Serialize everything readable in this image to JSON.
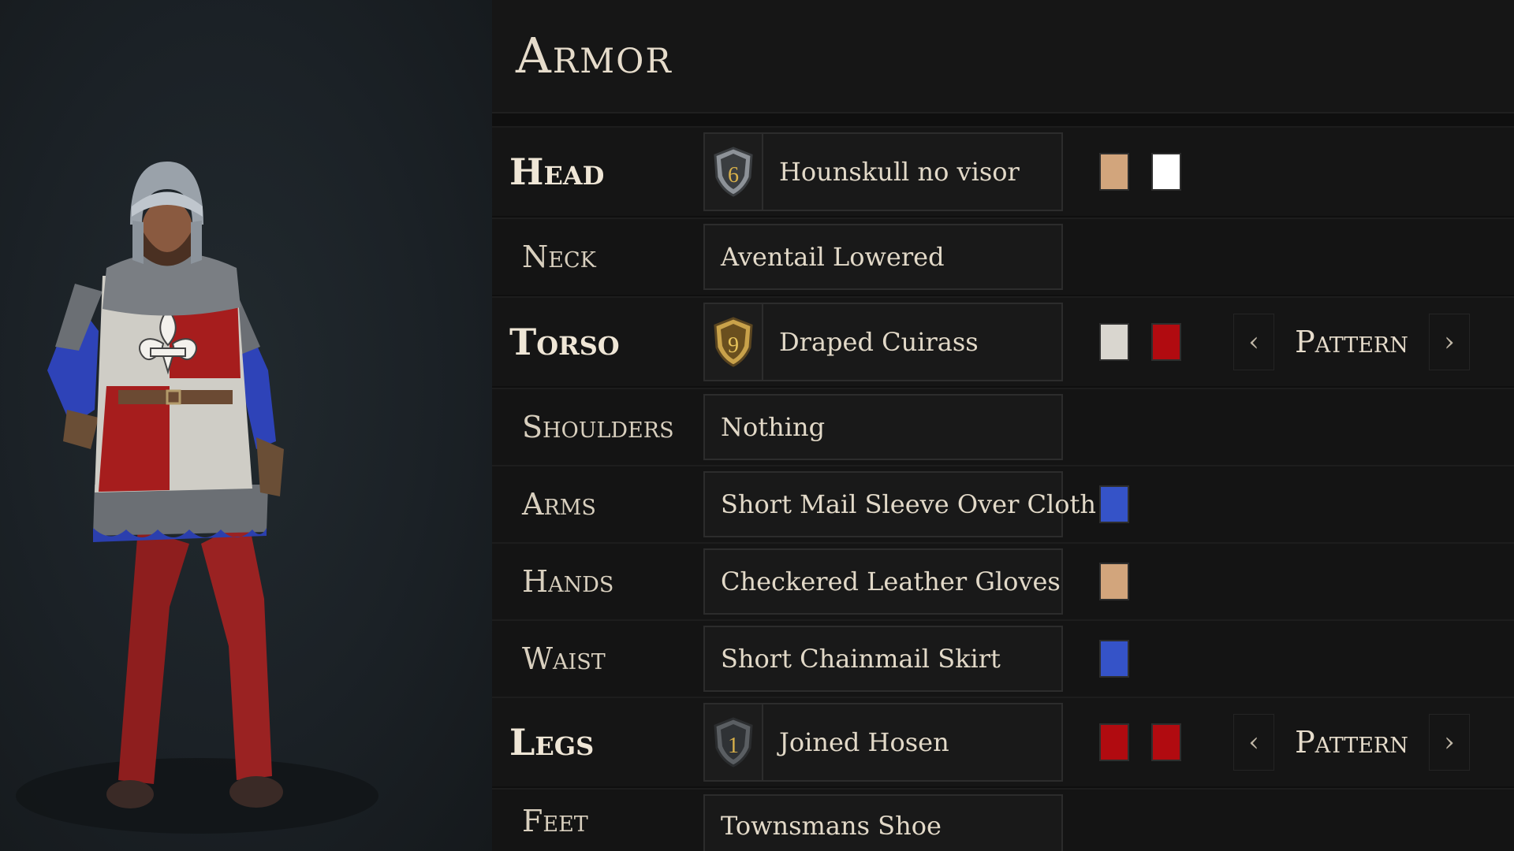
{
  "title": "Armor",
  "rows": [
    {
      "slot": "Head",
      "item": "Hounskull no visor",
      "tier": "6",
      "tier_style": "silver",
      "colors": [
        "#d2a57c",
        "#ffffff"
      ],
      "pattern": ""
    },
    {
      "slot": "Neck",
      "item": "Aventail Lowered"
    },
    {
      "slot": "Torso",
      "item": "Draped Cuirass",
      "tier": "9",
      "tier_style": "gold",
      "colors": [
        "#d9d6cf",
        "#b10b10"
      ],
      "pattern": "Pattern"
    },
    {
      "slot": "Shoulders",
      "item": "Nothing"
    },
    {
      "slot": "Arms",
      "item": "Short Mail Sleeve Over Cloth",
      "colors": [
        "#3553c8"
      ]
    },
    {
      "slot": "Hands",
      "item": "Checkered Leather Gloves",
      "colors": [
        "#d2a57c"
      ]
    },
    {
      "slot": "Waist",
      "item": "Short Chainmail Skirt",
      "colors": [
        "#3553c8"
      ]
    },
    {
      "slot": "Legs",
      "item": "Joined Hosen",
      "tier": "1",
      "tier_style": "grey",
      "colors": [
        "#b10b10",
        "#b10b10"
      ],
      "pattern": "Pattern"
    },
    {
      "slot": "Feet",
      "item": "Townsmans Shoe"
    }
  ],
  "icons": {
    "tier_badge": "shield-tier-icon",
    "prev": "chevron-left-icon",
    "next": "chevron-right-icon"
  },
  "prev_glyph": "‹",
  "next_glyph": "›"
}
